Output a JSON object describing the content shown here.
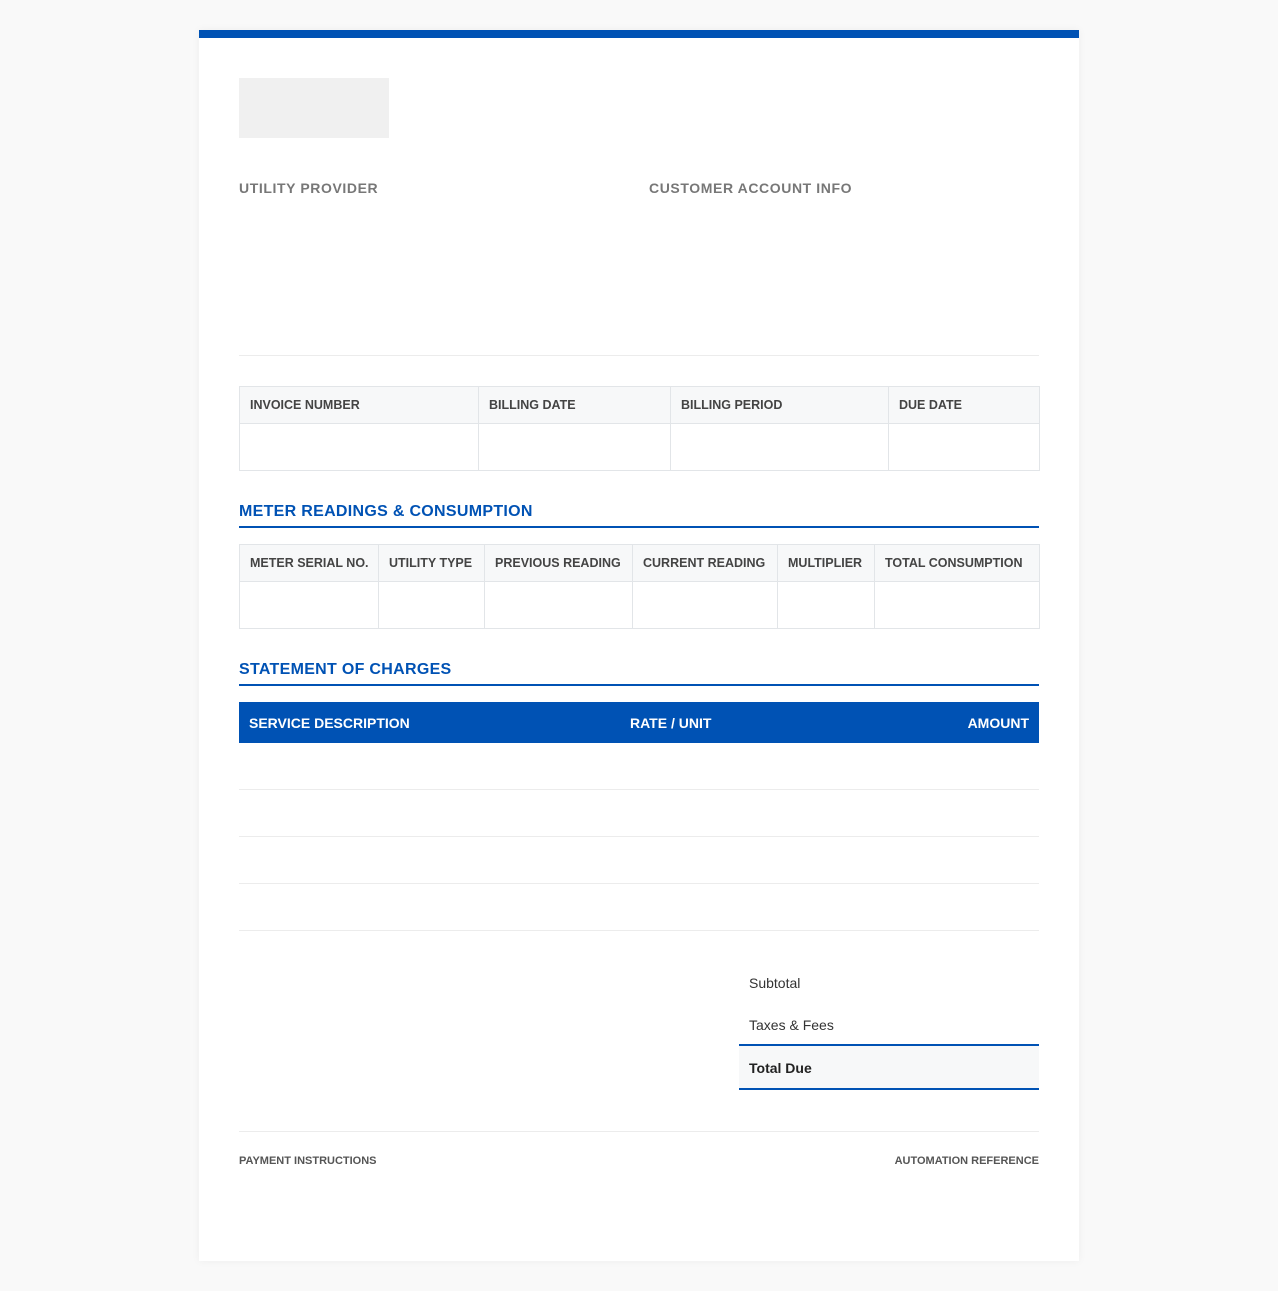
{
  "colors": {
    "accent": "#0052b4",
    "header_bg": "#f7f8f9",
    "border": "#e2e5e8"
  },
  "parties": {
    "provider_label": "UTILITY PROVIDER",
    "customer_label": "CUSTOMER ACCOUNT INFO"
  },
  "invoice_table": {
    "headers": [
      "INVOICE NUMBER",
      "BILLING DATE",
      "BILLING PERIOD",
      "DUE DATE"
    ]
  },
  "meter_section": {
    "title": "METER READINGS & CONSUMPTION",
    "headers": [
      "METER SERIAL NO.",
      "UTILITY TYPE",
      "PREVIOUS READING",
      "CURRENT READING",
      "MULTIPLIER",
      "TOTAL CONSUMPTION"
    ]
  },
  "charges_section": {
    "title": "STATEMENT OF CHARGES",
    "headers": {
      "description": "SERVICE DESCRIPTION",
      "rate": "RATE / UNIT",
      "amount": "AMOUNT"
    }
  },
  "totals": {
    "subtotal_label": "Subtotal",
    "taxes_label": "Taxes & Fees",
    "total_due_label": "Total Due"
  },
  "footer": {
    "payment_label": "PAYMENT INSTRUCTIONS",
    "automation_label": "AUTOMATION REFERENCE"
  }
}
